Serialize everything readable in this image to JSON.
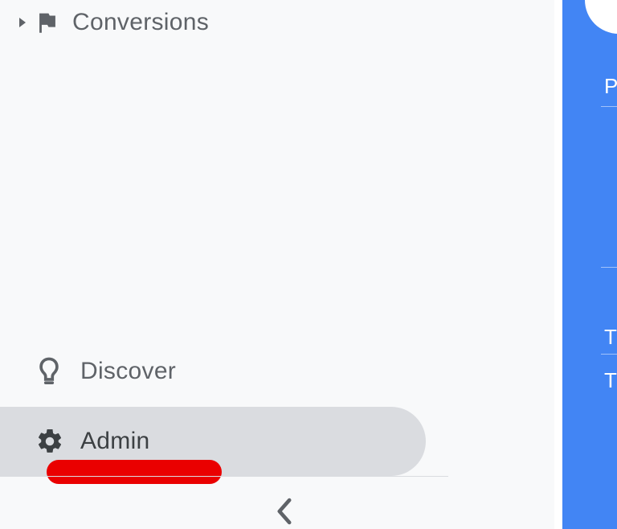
{
  "sidebar": {
    "items": {
      "conversions": {
        "label": "Conversions"
      },
      "discover": {
        "label": "Discover"
      },
      "admin": {
        "label": "Admin"
      }
    }
  },
  "right_panel": {
    "labels": {
      "a": "P",
      "b": "T",
      "c": "T"
    }
  },
  "annotation": {
    "color": "#ea0000"
  }
}
